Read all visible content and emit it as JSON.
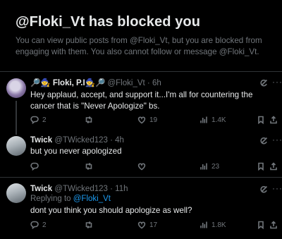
{
  "blocked": {
    "title": "@Floki_Vt has blocked you",
    "description": "You can view public posts from @Floki_Vt, but you are blocked from engaging with them. You also cannot follow or message @Floki_Vt."
  },
  "tweets": [
    {
      "name": "🔎🧙 Floki, P.I🧙🔎",
      "handle": "@Floki_Vt",
      "time": "6h",
      "text": "Hey applaud, accept, and support it...I'm all for countering the cancer that is \"Never Apologize\" bs.",
      "replies": "2",
      "retweets": "",
      "likes": "19",
      "views": "1.4K"
    },
    {
      "name": "Twick",
      "handle": "@TWicked123",
      "time": "4h",
      "text": "but you never apologized",
      "replies": "",
      "retweets": "",
      "likes": "",
      "views": "23"
    },
    {
      "name": "Twick",
      "handle": "@TWicked123",
      "time": "11h",
      "replying_label": "Replying to",
      "replying_handle": "@Floki_Vt",
      "text": "dont you think you should apologize as well?",
      "replies": "2",
      "retweets": "",
      "likes": "17",
      "views": "1.8K"
    }
  ],
  "icons": {
    "reply": "reply-icon",
    "retweet": "retweet-icon",
    "like": "heart-icon",
    "views": "views-icon",
    "bookmark": "bookmark-icon",
    "share": "share-icon",
    "grok": "grok-icon",
    "more": "more-icon"
  },
  "colors": {
    "background": "#000000",
    "text": "#e7e9ea",
    "muted": "#71767b",
    "link": "#1d9bf0",
    "divider": "#2f3336"
  }
}
